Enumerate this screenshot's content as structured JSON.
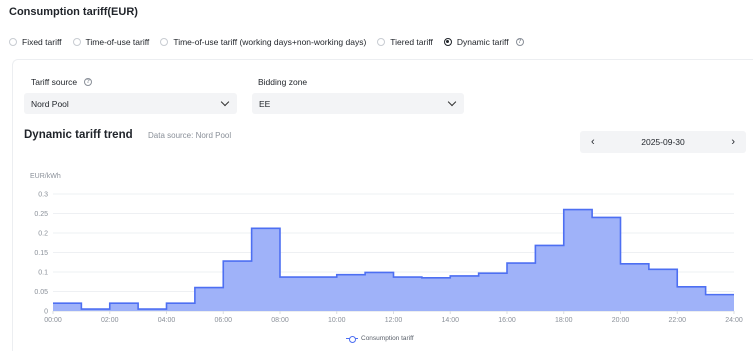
{
  "section_title": "Consumption tariff(EUR)",
  "tariff_types": {
    "options": [
      {
        "label": "Fixed tariff",
        "checked": false
      },
      {
        "label": "Time-of-use tariff",
        "checked": false
      },
      {
        "label": "Time-of-use tariff (working days+non-working days)",
        "checked": false
      },
      {
        "label": "Tiered tariff",
        "checked": false
      },
      {
        "label": "Dynamic tariff",
        "checked": true
      }
    ],
    "help_glyph": "?"
  },
  "tariff_source": {
    "label": "Tariff source",
    "help_glyph": "?",
    "value": "Nord Pool"
  },
  "bidding_zone": {
    "label": "Bidding zone",
    "value": "EE"
  },
  "trend": {
    "title": "Dynamic tariff trend",
    "source": "Data source: Nord Pool",
    "date": "2025-09-30",
    "prev_glyph": "‹",
    "next_glyph": "›"
  },
  "colors": {
    "series_line": "#4d6ff2",
    "series_fill": "#9aaef9",
    "grid": "#eef0f3"
  },
  "chart_data": {
    "type": "area",
    "step": true,
    "ylabel": "EUR/kWh",
    "ylim": [
      0,
      0.3
    ],
    "yticks": [
      "0",
      "0.05",
      "0.1",
      "0.15",
      "0.2",
      "0.25",
      "0.3"
    ],
    "xlim": [
      0,
      24
    ],
    "xticks": [
      "00:00",
      "02:00",
      "04:00",
      "06:00",
      "08:00",
      "10:00",
      "12:00",
      "14:00",
      "16:00",
      "18:00",
      "20:00",
      "22:00",
      "24:00"
    ],
    "series": [
      {
        "name": "Consumption tariff",
        "hours": [
          0,
          1,
          2,
          3,
          4,
          5,
          6,
          7,
          8,
          9,
          10,
          11,
          12,
          13,
          14,
          15,
          16,
          17,
          18,
          19,
          20,
          21,
          22,
          23
        ],
        "values": [
          0.02,
          0.005,
          0.02,
          0.005,
          0.02,
          0.06,
          0.128,
          0.212,
          0.087,
          0.087,
          0.093,
          0.099,
          0.087,
          0.085,
          0.09,
          0.097,
          0.123,
          0.168,
          0.26,
          0.24,
          0.121,
          0.107,
          0.062,
          0.042
        ]
      }
    ],
    "grid": true,
    "legend_position": "bottom-center"
  }
}
